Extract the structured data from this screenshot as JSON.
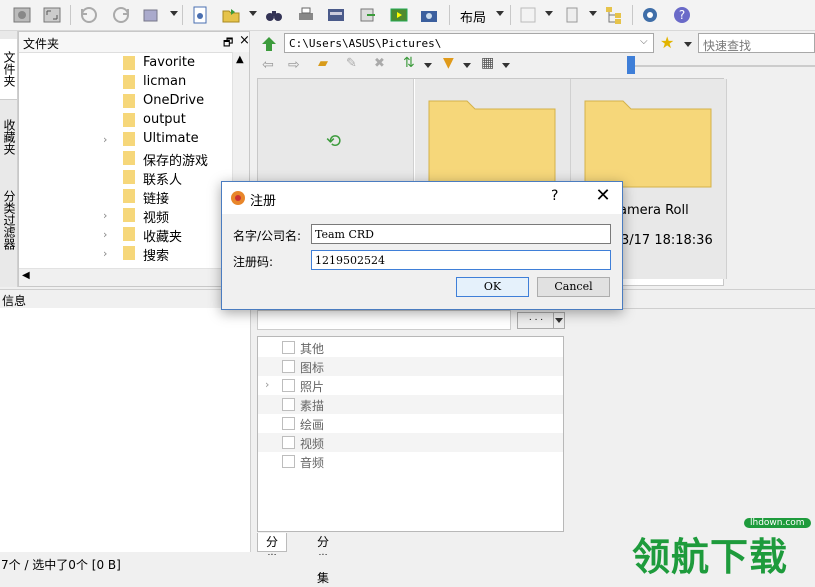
{
  "toolbar": {
    "layout_label": "布局"
  },
  "side_tabs": [
    "文件夹",
    "收藏夹",
    "分类过滤器"
  ],
  "folder_pane": {
    "title": "文件夹",
    "pin": "🗗",
    "items": [
      {
        "label": "Favorite",
        "expandable": false
      },
      {
        "label": "licman",
        "expandable": false
      },
      {
        "label": "OneDrive",
        "expandable": false
      },
      {
        "label": "output",
        "expandable": false
      },
      {
        "label": "Ultimate",
        "expandable": true
      },
      {
        "label": "保存的游戏",
        "expandable": false
      },
      {
        "label": "联系人",
        "expandable": false
      },
      {
        "label": "链接",
        "expandable": false
      },
      {
        "label": "视频",
        "expandable": true
      },
      {
        "label": "收藏夹",
        "expandable": true
      },
      {
        "label": "搜索",
        "expandable": true
      }
    ]
  },
  "address": {
    "path": "C:\\Users\\ASUS\\Pictures\\",
    "search_placeholder": "快速查找"
  },
  "thumbnails": {
    "label": "amera Roll",
    "date": "3/17 18:18:36"
  },
  "info": {
    "title": "信息",
    "dots": ". . ."
  },
  "categories": [
    {
      "label": "其他",
      "expandable": false
    },
    {
      "label": "图标",
      "expandable": false
    },
    {
      "label": "照片",
      "expandable": true
    },
    {
      "label": "素描",
      "expandable": false
    },
    {
      "label": "绘画",
      "expandable": false
    },
    {
      "label": "视频",
      "expandable": false
    },
    {
      "label": "音频",
      "expandable": false
    }
  ],
  "bottom_tabs": [
    "分类",
    "分类集"
  ],
  "status": "7个 / 选中了0个 [0 B]",
  "watermark": {
    "url": "lhdown.com",
    "text": "领航下载"
  },
  "dialog": {
    "title": "注册",
    "help": "?",
    "close": "✕",
    "name_label": "名字/公司名:",
    "name_value": "Team CRD",
    "code_label": "注册码:",
    "code_value": "1219502524",
    "ok": "OK",
    "cancel": "Cancel"
  },
  "colors": {
    "folder": "#f6d77a",
    "accent": "#3f7fd8",
    "watermark": "#1e9b3c"
  }
}
